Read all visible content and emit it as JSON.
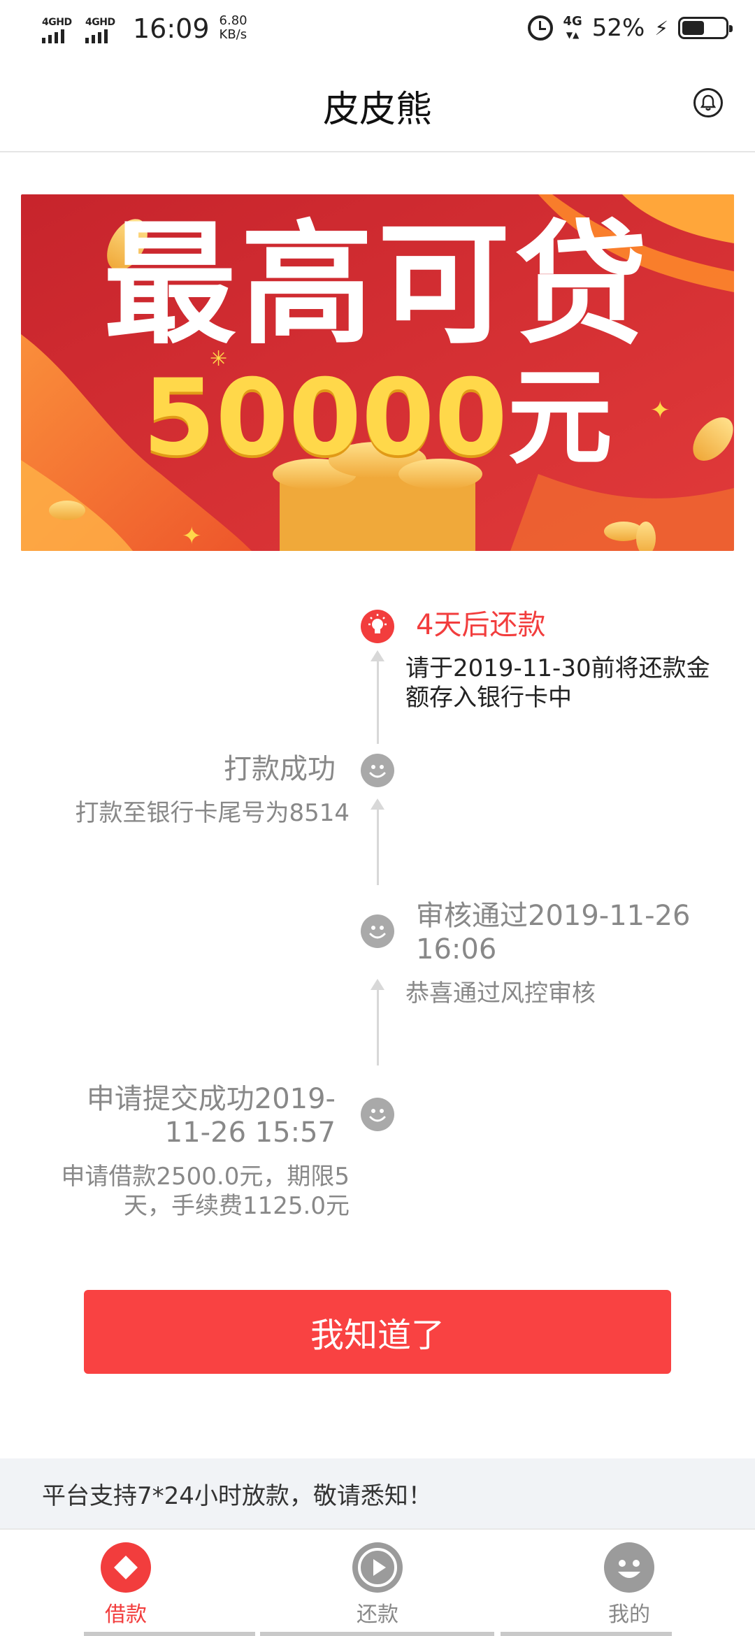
{
  "status_bar": {
    "network_1": "4GHD",
    "network_2": "4GHD",
    "time": "16:09",
    "speed_value": "6.80",
    "speed_unit": "KB/s",
    "network_type": "4G",
    "battery_percent": "52%",
    "battery_level": 0.52
  },
  "header": {
    "title": "皮皮熊",
    "notification_icon": "bell-icon"
  },
  "banner": {
    "line1": "最高可贷",
    "amount": "50000",
    "unit": "元"
  },
  "timeline": [
    {
      "title": "4天后还款",
      "description": "请于2019-11-30前将还款金额存入银行卡中",
      "status": "active",
      "icon": "lightbulb-icon"
    },
    {
      "title": "打款成功",
      "description": "打款至银行卡尾号为8514",
      "status": "done",
      "icon": "smiley-icon"
    },
    {
      "title": "审核通过2019-11-26 16:06",
      "description": "恭喜通过风控审核",
      "status": "done",
      "icon": "smiley-icon"
    },
    {
      "title": "申请提交成功2019-11-26 15:57",
      "description": "申请借款2500.0元，期限5天，手续费1125.0元",
      "status": "done",
      "icon": "smiley-icon"
    }
  ],
  "primary_button": "我知道了",
  "notice": "平台支持7*24小时放款，敬请悉知！",
  "tabs": [
    {
      "label": "借款",
      "icon": "diamond-icon",
      "active": true
    },
    {
      "label": "还款",
      "icon": "play-icon",
      "active": false
    },
    {
      "label": "我的",
      "icon": "smiley-icon",
      "active": false
    }
  ],
  "colors": {
    "accent": "#f94242",
    "active_text": "#f23d3d",
    "inactive": "#a9a9a9",
    "notice_bg": "#f1f3f6"
  }
}
